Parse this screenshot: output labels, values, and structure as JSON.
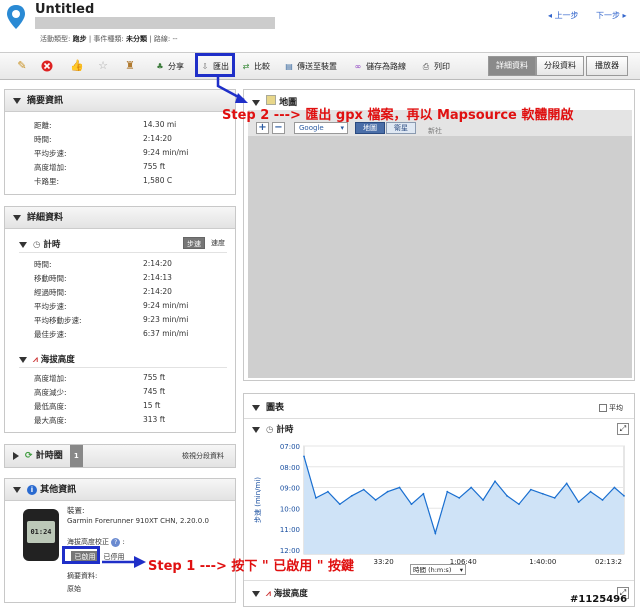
{
  "header": {
    "title": "Untitled",
    "activity_label": "活動類型:",
    "activity_value": "跑步",
    "event_label": "| 事件種類:",
    "event_value": "未分類",
    "course_label": "| 路線:",
    "course_value": "--",
    "prev": "上一步",
    "next": "下一步"
  },
  "toolbar": {
    "share": "分享",
    "export": "匯出",
    "compare": "比較",
    "send": "傳送至裝置",
    "save_course": "儲存為路線",
    "print": "列印",
    "tab_details": "詳細資料",
    "tab_splits": "分段資料",
    "tab_player": "播放器"
  },
  "summary": {
    "title": "摘要資訊",
    "rows": [
      {
        "label": "距離:",
        "value": "14.30 mi"
      },
      {
        "label": "時間:",
        "value": "2:14:20"
      },
      {
        "label": "平均步速:",
        "value": "9:24 min/mi"
      },
      {
        "label": "高度增加:",
        "value": "755 ft"
      },
      {
        "label": "卡路里:",
        "value": "1,580 C"
      }
    ]
  },
  "details": {
    "title": "詳細資料",
    "timing_title": "計時",
    "pace_btn": "步速",
    "speed_btn": "速度",
    "timing_rows": [
      {
        "label": "時間:",
        "value": "2:14:20"
      },
      {
        "label": "移動時間:",
        "value": "2:14:13"
      },
      {
        "label": "經過時間:",
        "value": "2:14:20"
      },
      {
        "label": "平均步速:",
        "value": "9:24 min/mi"
      },
      {
        "label": "平均移動步速:",
        "value": "9:23 min/mi"
      },
      {
        "label": "最佳步速:",
        "value": "6:37 min/mi"
      }
    ],
    "elev_title": "海拔高度",
    "elev_rows": [
      {
        "label": "高度增加:",
        "value": "755 ft"
      },
      {
        "label": "高度減少:",
        "value": "745 ft"
      },
      {
        "label": "最低高度:",
        "value": "15 ft"
      },
      {
        "label": "最大高度:",
        "value": "313 ft"
      }
    ]
  },
  "laps": {
    "title": "計時圈",
    "count": "1",
    "link": "檢視分段資料"
  },
  "other": {
    "title": "其他資訊",
    "device_label": "裝置:",
    "device_value": "Garmin Forerunner 910XT CHN, 2.20.0.0",
    "watch_time": "01:24",
    "elev_corr_label": "海拔高度校正",
    "elev_corr_q": "?",
    "enabled_btn": "已啟用",
    "disabled_btn": "已停用",
    "summary_label": "摘要資料:",
    "summary_value": "原始"
  },
  "map": {
    "title": "地圖",
    "zoom_in": "+",
    "zoom_out": "−",
    "provider": "Google",
    "map_btn": "地圖",
    "sat_btn": "衛星",
    "place": "新社"
  },
  "chart_panel": {
    "title": "圖表",
    "avg_label": "平均",
    "timing_title": "計時",
    "ylabel": "步速 (min/mi)",
    "xaxis_select": "時間 (h:m:s)",
    "elev_title": "海拔高度"
  },
  "annotations": {
    "step2": "Step 2 ---> 匯出 gpx 檔案，再以 Mapsource 軟體開啟",
    "step1": "Step 1 ---> 按下 \" 已啟用 \" 按鍵"
  },
  "watermark": "#1125496",
  "chart_data": {
    "type": "area",
    "title": "",
    "xlabel": "時間 (h:m:s)",
    "ylabel": "步速 (min/mi)",
    "x_ticks": [
      "33:20",
      "1:06:40",
      "1:40:00",
      "02:13:2"
    ],
    "y_ticks": [
      "07:00",
      "08:00",
      "09:00",
      "10:00",
      "11:00",
      "12:00"
    ],
    "ylim": [
      7,
      12.2
    ],
    "y_inverted": true,
    "x": [
      0,
      5,
      10,
      15,
      20,
      25,
      30,
      35,
      40,
      45,
      50,
      55,
      60,
      65,
      70,
      75,
      80,
      85,
      90,
      95,
      100,
      105,
      110,
      115,
      120,
      125,
      130,
      134
    ],
    "values": [
      7.5,
      9.5,
      9.2,
      9.8,
      9.4,
      9.1,
      9.6,
      9.2,
      9.0,
      9.8,
      9.3,
      11.2,
      9.2,
      9.5,
      9.0,
      9.6,
      8.7,
      9.4,
      9.8,
      9.1,
      9.3,
      9.5,
      8.8,
      9.7,
      9.2,
      9.6,
      9.0,
      9.4
    ],
    "colors": {
      "line": "#1a6fd0",
      "fill": "#cfe3f7"
    }
  }
}
